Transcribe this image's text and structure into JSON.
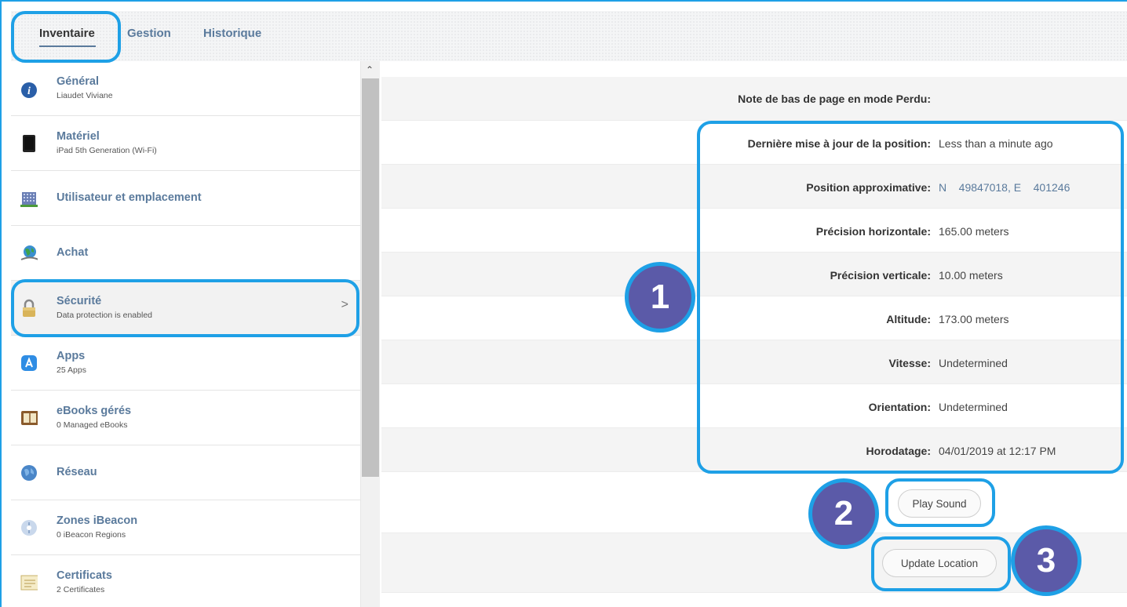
{
  "tabs": [
    {
      "label": "Inventaire"
    },
    {
      "label": "Gestion"
    },
    {
      "label": "Historique"
    }
  ],
  "sidebar": {
    "items": [
      {
        "title": "Général",
        "subtitle": "Liaudet Viviane",
        "icon": "info-icon"
      },
      {
        "title": "Matériel",
        "subtitle": "iPad 5th Generation (Wi-Fi)",
        "icon": "ipad-icon"
      },
      {
        "title": "Utilisateur et emplacement",
        "subtitle": "",
        "icon": "building-icon"
      },
      {
        "title": "Achat",
        "subtitle": "",
        "icon": "globe-purchase-icon"
      },
      {
        "title": "Sécurité",
        "subtitle": "Data protection is enabled",
        "icon": "padlock-icon"
      },
      {
        "title": "Apps",
        "subtitle": "25 Apps",
        "icon": "app-store-icon"
      },
      {
        "title": "eBooks gérés",
        "subtitle": "0 Managed eBooks",
        "icon": "ebook-icon"
      },
      {
        "title": "Réseau",
        "subtitle": "",
        "icon": "network-globe-icon"
      },
      {
        "title": "Zones iBeacon",
        "subtitle": "0 iBeacon Regions",
        "icon": "ibeacon-icon"
      },
      {
        "title": "Certificats",
        "subtitle": "2 Certificates",
        "icon": "certificate-icon"
      }
    ],
    "chevron": ">"
  },
  "details": {
    "rows": [
      {
        "label": "Note de bas de page en mode Perdu:",
        "value": ""
      },
      {
        "label": "Dernière mise à jour de la position:",
        "value": "Less than a minute ago"
      },
      {
        "label": "Position approximative:",
        "value": "N    49847018, E    401246"
      },
      {
        "label": "Précision horizontale:",
        "value": "165.00 meters"
      },
      {
        "label": "Précision verticale:",
        "value": "10.00 meters"
      },
      {
        "label": "Altitude:",
        "value": "173.00 meters"
      },
      {
        "label": "Vitesse:",
        "value": "Undetermined"
      },
      {
        "label": "Orientation:",
        "value": "Undetermined"
      },
      {
        "label": "Horodatage:",
        "value": "04/01/2019 at 12:17 PM"
      }
    ]
  },
  "buttons": {
    "play_sound": "Play Sound",
    "update_location": "Update Location"
  },
  "badges": [
    "1",
    "2",
    "3"
  ],
  "colors": {
    "highlight": "#1ea0e6",
    "badge": "#5b5aa8",
    "link": "#5a7a9c"
  }
}
